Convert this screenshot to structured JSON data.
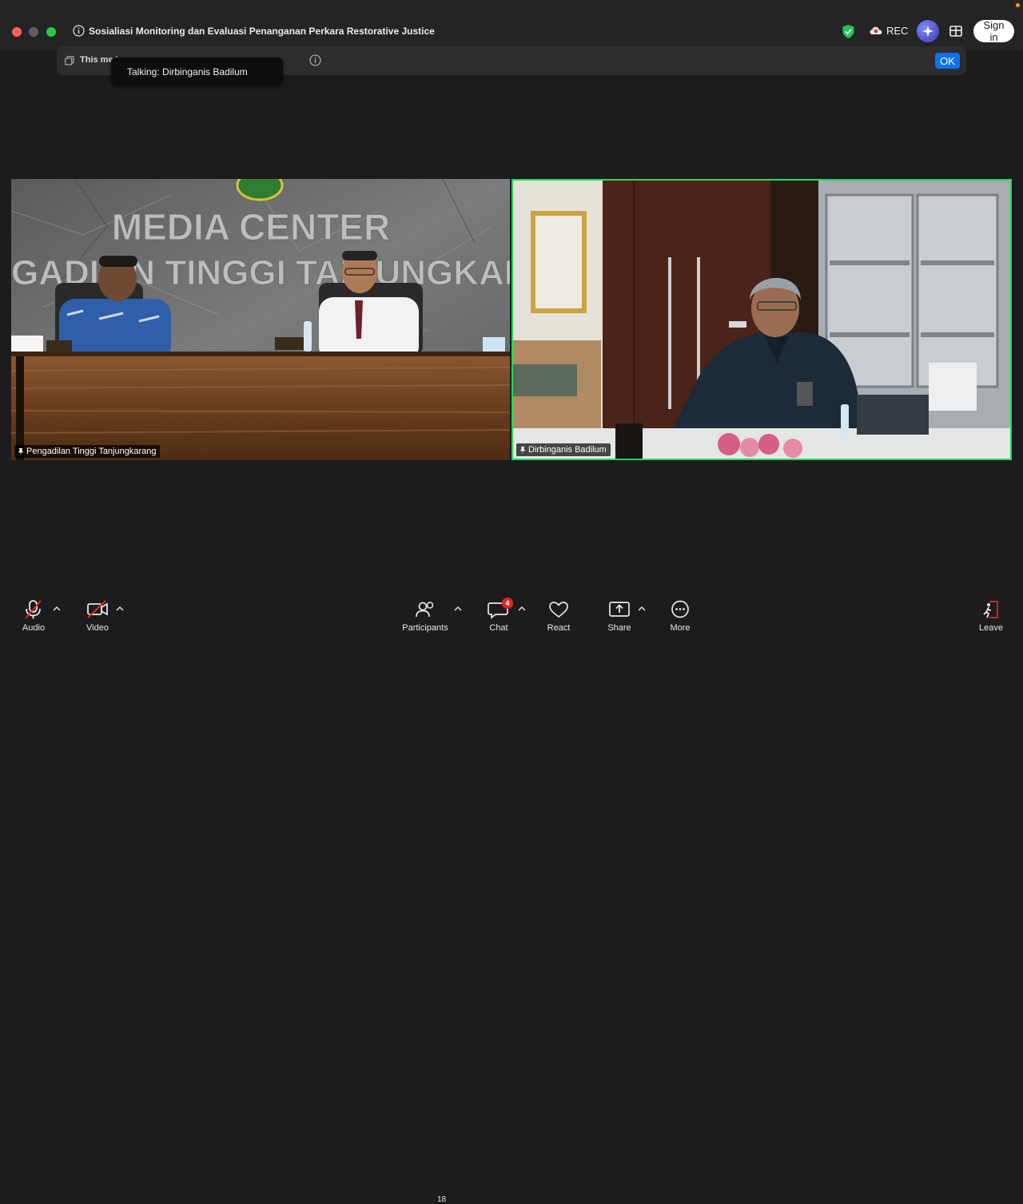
{
  "window": {
    "title": "Sosialiasi Monitoring dan Evaluasi Penanganan Perkara Restorative Justice",
    "rec_label": "REC",
    "sign_in_label": "Sign in"
  },
  "notice": {
    "text": "This me                                                    's on.",
    "ok_label": "OK"
  },
  "tooltip": {
    "talking": "Talking: Dirbinganis Badilum"
  },
  "videos": [
    {
      "name": "Pengadilan Tinggi Tanjungkarang",
      "sign_line1": "MEDIA CENTER",
      "sign_line2": "GADIL  N TINGGI TAN  UNGKAR"
    },
    {
      "name": "Dirbinganis Badilum"
    }
  ],
  "toolbar": {
    "audio": "Audio",
    "video": "Video",
    "participants": "Participants",
    "participants_count": "18",
    "chat": "Chat",
    "chat_badge": "4",
    "react": "React",
    "share": "Share",
    "more": "More",
    "leave": "Leave"
  },
  "colors": {
    "speaker_border": "#23d959",
    "ok_button": "#0e72ed",
    "leave_red": "#e02828"
  }
}
